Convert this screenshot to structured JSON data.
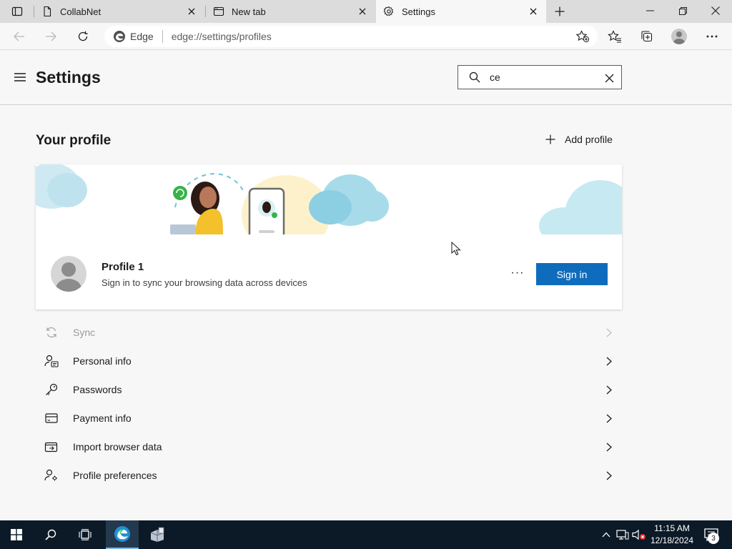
{
  "browser": {
    "tabs": [
      {
        "title": "CollabNet",
        "icon": "page-icon",
        "active": false
      },
      {
        "title": "New tab",
        "icon": "newtab-icon",
        "active": false
      },
      {
        "title": "Settings",
        "icon": "gear-icon",
        "active": true
      }
    ],
    "address": {
      "site_label": "Edge",
      "url": "edge://settings/profiles"
    }
  },
  "settings": {
    "title": "Settings",
    "search": {
      "value": "ce"
    },
    "profile_section": {
      "title": "Your profile",
      "add_profile_label": "Add profile",
      "profile": {
        "name": "Profile 1",
        "subtitle": "Sign in to sync your browsing data across devices",
        "more_label": "···",
        "signin_label": "Sign in"
      }
    },
    "menu": [
      {
        "label": "Sync",
        "icon": "sync-icon",
        "disabled": true
      },
      {
        "label": "Personal info",
        "icon": "personal-info-icon",
        "disabled": false
      },
      {
        "label": "Passwords",
        "icon": "key-icon",
        "disabled": false
      },
      {
        "label": "Payment info",
        "icon": "credit-card-icon",
        "disabled": false
      },
      {
        "label": "Import browser data",
        "icon": "import-icon",
        "disabled": false
      },
      {
        "label": "Profile preferences",
        "icon": "profile-preferences-icon",
        "disabled": false
      }
    ]
  },
  "taskbar": {
    "time": "11:15 AM",
    "date": "12/18/2024",
    "notification_count": "3"
  },
  "colors": {
    "accent": "#0f6cbd",
    "taskbar": "#0c1a28"
  }
}
